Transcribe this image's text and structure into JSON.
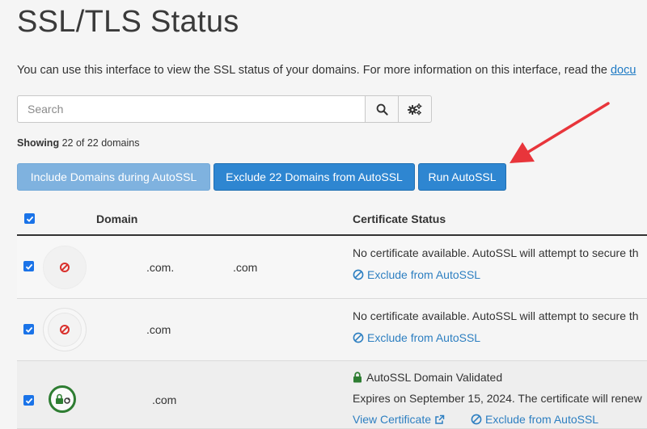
{
  "page": {
    "title": "SSL/TLS Status",
    "intro_text": "You can use this interface to view the SSL status of your domains. For more information on this interface, read the ",
    "intro_link": "docu"
  },
  "search": {
    "placeholder": "Search"
  },
  "showing": {
    "label": "Showing",
    "count_text": "22 of 22 domains"
  },
  "actions": {
    "include_label": "Include Domains during AutoSSL",
    "exclude_label": "Exclude 22 Domains from AutoSSL",
    "run_label": "Run AutoSSL"
  },
  "table": {
    "headers": {
      "domain": "Domain",
      "certificate_status": "Certificate Status"
    },
    "rows": [
      {
        "domain_part1": ".com.",
        "domain_part2": ".com",
        "status_line1": "No certificate available. AutoSSL will attempt to secure th",
        "exclude_label": "Exclude from AutoSSL"
      },
      {
        "domain_part1": ".com",
        "status_line1": "No certificate available. AutoSSL will attempt to secure th",
        "exclude_label": "Exclude from AutoSSL"
      },
      {
        "domain_part1": ".com",
        "status_line1": "AutoSSL Domain Validated",
        "status_line2": "Expires on September 15, 2024. The certificate will renew",
        "view_label": "View Certificate",
        "exclude_label": "Exclude from AutoSSL"
      }
    ]
  },
  "colors": {
    "primary_button": "#2e86d1",
    "disabled_button": "#7fb2df",
    "link": "#2d7fc1",
    "error_icon": "#d9302c",
    "success_icon": "#2e7d32",
    "annotation_arrow": "#e8353b"
  }
}
